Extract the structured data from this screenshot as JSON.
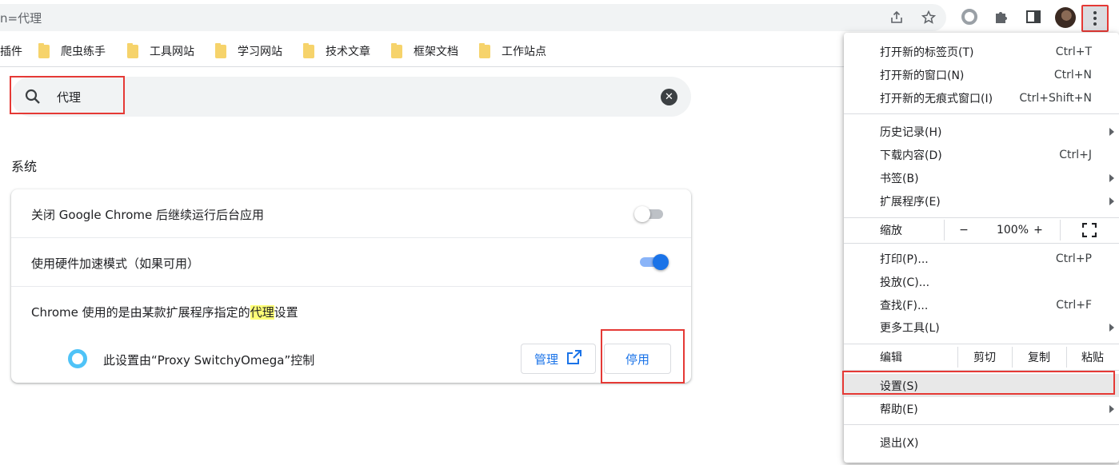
{
  "omnibox": {
    "url_text": "n=代理"
  },
  "bookmarks": [
    {
      "label": "插件",
      "folder": false
    },
    {
      "label": "爬虫练手",
      "folder": true
    },
    {
      "label": "工具网站",
      "folder": true
    },
    {
      "label": "学习网站",
      "folder": true
    },
    {
      "label": "技术文章",
      "folder": true
    },
    {
      "label": "框架文档",
      "folder": true
    },
    {
      "label": "工作站点",
      "folder": true
    }
  ],
  "settings": {
    "search_value": "代理",
    "section_title": "系统",
    "rows": {
      "background_apps": {
        "label": "关闭 Google Chrome 后继续运行后台应用",
        "enabled": false
      },
      "hw_accel": {
        "label": "使用硬件加速模式（如果可用）",
        "enabled": true
      },
      "proxy": {
        "label_prefix": "Chrome 使用的是由某款扩展程序指定的",
        "label_highlight": "代理",
        "label_suffix": "设置",
        "controlled_by": "此设置由“Proxy SwitchyOmega”控制",
        "manage_label": "管理",
        "disable_label": "停用"
      }
    }
  },
  "menu": {
    "new_tab": {
      "label": "打开新的标签页(T)",
      "shortcut": "Ctrl+T"
    },
    "new_window": {
      "label": "打开新的窗口(N)",
      "shortcut": "Ctrl+N"
    },
    "incognito": {
      "label": "打开新的无痕式窗口(I)",
      "shortcut": "Ctrl+Shift+N"
    },
    "history": {
      "label": "历史记录(H)"
    },
    "downloads": {
      "label": "下载内容(D)",
      "shortcut": "Ctrl+J"
    },
    "bookmarks": {
      "label": "书签(B)"
    },
    "extensions": {
      "label": "扩展程序(E)"
    },
    "zoom": {
      "label": "缩放",
      "minus": "−",
      "value": "100%",
      "plus": "+"
    },
    "print": {
      "label": "打印(P)...",
      "shortcut": "Ctrl+P"
    },
    "cast": {
      "label": "投放(C)..."
    },
    "find": {
      "label": "查找(F)...",
      "shortcut": "Ctrl+F"
    },
    "more_tools": {
      "label": "更多工具(L)"
    },
    "edit": {
      "label": "编辑",
      "cut": "剪切",
      "copy": "复制",
      "paste": "粘贴"
    },
    "settings": {
      "label": "设置(S)"
    },
    "help": {
      "label": "帮助(E)"
    },
    "exit": {
      "label": "退出(X)"
    }
  },
  "colors": {
    "accent": "#1a73e8",
    "highlight": "#e53935",
    "match": "#ffff77"
  }
}
